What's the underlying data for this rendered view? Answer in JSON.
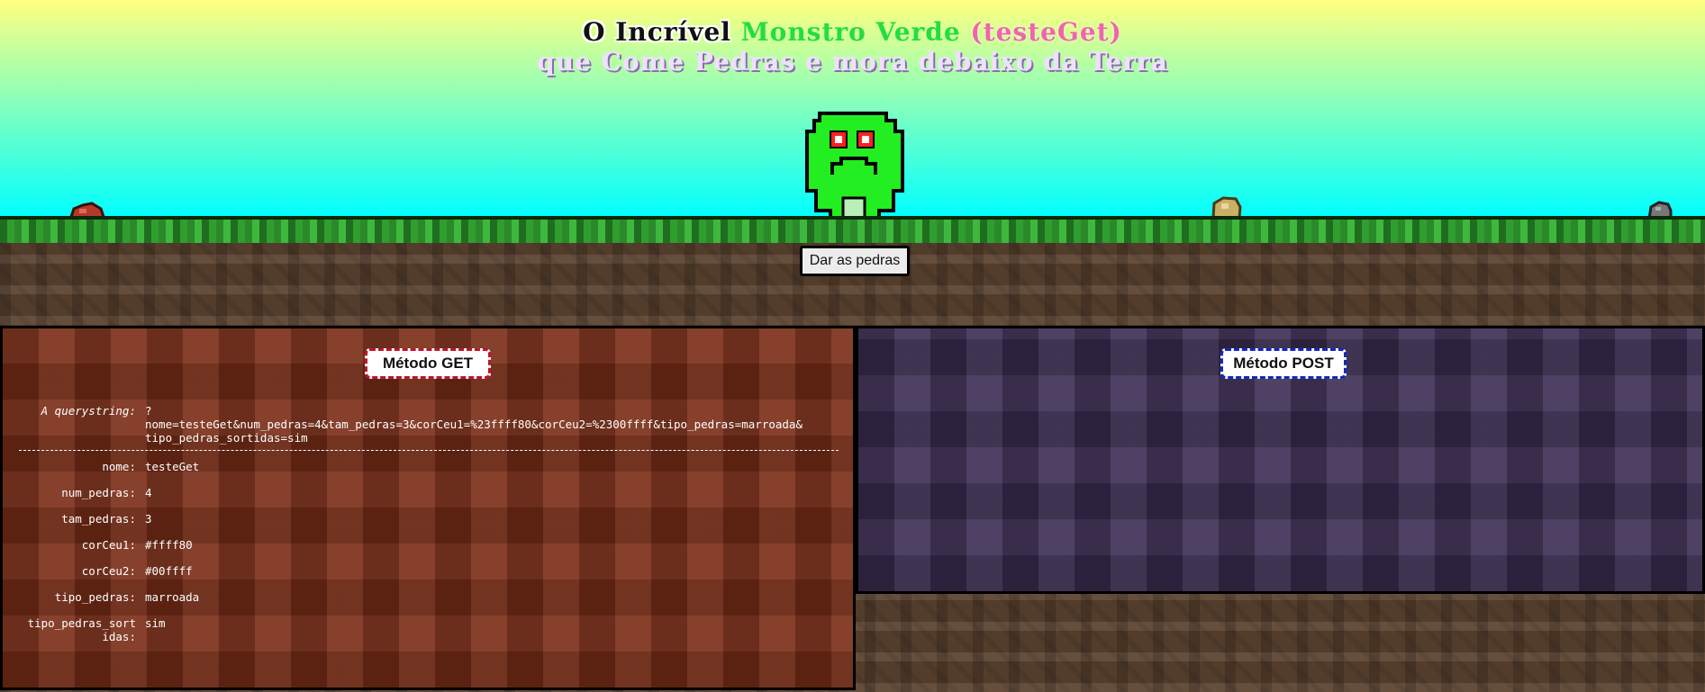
{
  "title": {
    "line1_part1": "O Incrível",
    "line1_part2": "Monstro Verde",
    "line1_part3": "(testeGet)",
    "line2": "que Come Pedras e mora debaixo da Terra"
  },
  "button": {
    "label": "Dar as pedras"
  },
  "colors": {
    "sky_top": "#ffff80",
    "sky_bottom": "#00ffff",
    "monster": "#22ee22"
  },
  "get_panel": {
    "title": "Método GET",
    "querystring_label_prefix": "A ",
    "querystring_label_italic": "querystring",
    "querystring_label_suffix": ":",
    "querystring_value": "?\nnome=testeGet&num_pedras=4&tam_pedras=3&corCeu1=%23ffff80&corCeu2=%2300ffff&tipo_pedras=marroada&\ntipo_pedras_sortidas=sim",
    "params": [
      {
        "key": "nome:",
        "value": "testeGet"
      },
      {
        "key": "num_pedras:",
        "value": "4"
      },
      {
        "key": "tam_pedras:",
        "value": "3"
      },
      {
        "key": "corCeu1:",
        "value": "#ffff80"
      },
      {
        "key": "corCeu2:",
        "value": "#00ffff"
      },
      {
        "key": "tipo_pedras:",
        "value": "marroada"
      },
      {
        "key": "tipo_pedras_sort\nidas:",
        "value": "sim"
      }
    ]
  },
  "post_panel": {
    "title": "Método POST"
  }
}
